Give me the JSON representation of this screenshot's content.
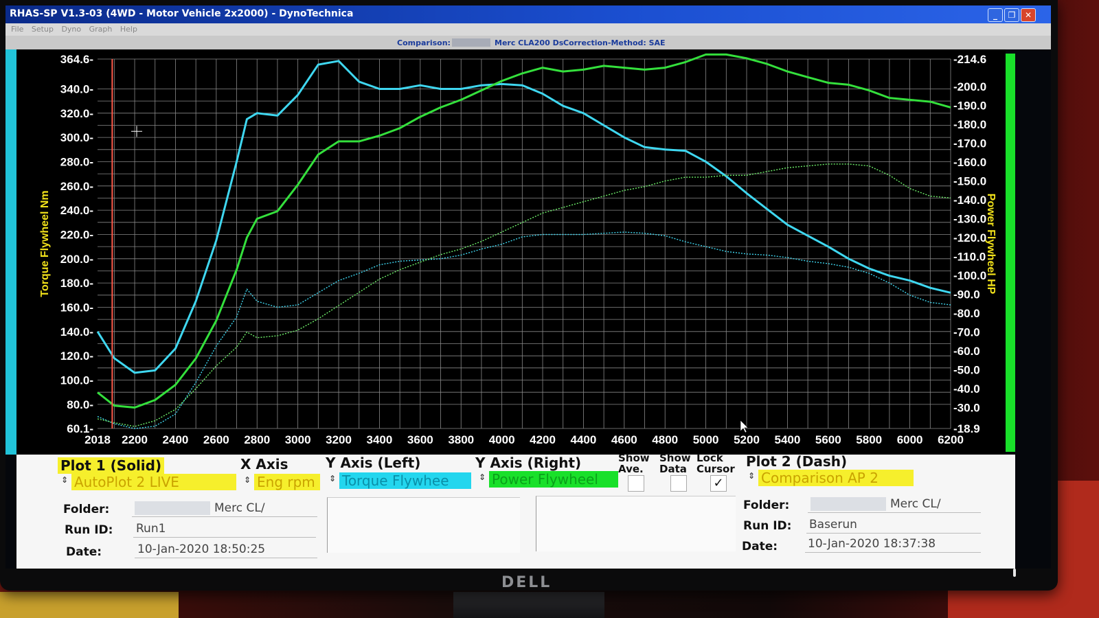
{
  "window": {
    "title": "RHAS-SP V1.3-03  (4WD - Motor Vehicle 2x2000) - DynoTechnica",
    "controls": [
      "_",
      "❐",
      "✕"
    ]
  },
  "menu": {
    "items": [
      "File",
      "Setup",
      "Dyno",
      "Graph",
      "Help"
    ]
  },
  "infobar": {
    "comparison_label": "Comparison:",
    "vehicle": "Merc CLA200 Ds",
    "correction_label": "Correction-Method: SAE"
  },
  "chart_data": {
    "type": "line",
    "x": [
      2018,
      2100,
      2200,
      2300,
      2400,
      2500,
      2600,
      2700,
      2750,
      2800,
      2900,
      3000,
      3100,
      3200,
      3300,
      3400,
      3500,
      3600,
      3700,
      3800,
      3900,
      4000,
      4100,
      4200,
      4300,
      4400,
      4500,
      4600,
      4700,
      4800,
      4900,
      5000,
      5100,
      5200,
      5300,
      5400,
      5500,
      5600,
      5700,
      5800,
      5900,
      6000,
      6100,
      6200
    ],
    "xlim": [
      2018,
      6200
    ],
    "x_ticks": [
      "2018",
      "2200",
      "2400",
      "2600",
      "2800",
      "3000",
      "3200",
      "3400",
      "3600",
      "3800",
      "4000",
      "4200",
      "4400",
      "4600",
      "4800",
      "5000",
      "5200",
      "5400",
      "5600",
      "5800",
      "6000",
      "6200"
    ],
    "ylabel": "Torque Flywheel Nm",
    "ylim": [
      60.1,
      364.6
    ],
    "y_ticks": [
      "364.6-",
      "340.0-",
      "320.0-",
      "300.0-",
      "280.0-",
      "260.0-",
      "240.0-",
      "220.0-",
      "200.0-",
      "180.0-",
      "160.0-",
      "140.0-",
      "120.0-",
      "100.0-",
      "80.0-",
      "60.1-"
    ],
    "y_tick_values": [
      364.6,
      340,
      320,
      300,
      280,
      260,
      240,
      220,
      200,
      180,
      160,
      140,
      120,
      100,
      80,
      60.1
    ],
    "y2label": "Power Flywheel HP",
    "y2lim": [
      18.9,
      214.6
    ],
    "y2_ticks": [
      "214.6",
      "200.0",
      "190.0",
      "180.0",
      "170.0",
      "160.0",
      "150.0",
      "140.0",
      "130.0",
      "120.0",
      "110.0",
      "100.0",
      "90.0",
      "80.0",
      "70.0",
      "60.0",
      "50.0",
      "40.0",
      "30.0",
      "18.9"
    ],
    "y2_tick_values": [
      214.6,
      200,
      190,
      180,
      170,
      160,
      150,
      140,
      130,
      120,
      110,
      100,
      90,
      80,
      70,
      60,
      50,
      40,
      30,
      18.9
    ],
    "grid": true,
    "cursor_rpm": 2090,
    "series": [
      {
        "axis": "left",
        "color": "#3fd7f0",
        "dash": false,
        "values": [
          140,
          118,
          106,
          108,
          126,
          165,
          215,
          280,
          315,
          320,
          318,
          335,
          360,
          363,
          346,
          340,
          340,
          343,
          340,
          340,
          343,
          344,
          343,
          336,
          326,
          320,
          310,
          300,
          292,
          290,
          289,
          280,
          268,
          254,
          241,
          228,
          219,
          210,
          200,
          192,
          186,
          182,
          176,
          172
        ]
      },
      {
        "axis": "right",
        "color": "#34e03c",
        "dash": false,
        "values": [
          38,
          31,
          30,
          34,
          42,
          56,
          76,
          103,
          120,
          130,
          134,
          148,
          164,
          171,
          171,
          174,
          178,
          184,
          189,
          193,
          198,
          203,
          207,
          210,
          208,
          209,
          211,
          210,
          209,
          210,
          213,
          217,
          217,
          215,
          212,
          208,
          205,
          202,
          201,
          198,
          194,
          193,
          192,
          189
        ]
      },
      {
        "axis": "left",
        "color": "#3fd7f0",
        "dash": true,
        "values": [
          70,
          64,
          60,
          62,
          72,
          98,
          128,
          152,
          175,
          165,
          160,
          162,
          172,
          182,
          188,
          195,
          198,
          199,
          200,
          203,
          208,
          212,
          218,
          220,
          220,
          220,
          221,
          222,
          221,
          219,
          214,
          210,
          206,
          204,
          203,
          201,
          198,
          196,
          193,
          188,
          180,
          170,
          164,
          162
        ]
      },
      {
        "axis": "right",
        "color": "#6ef06a",
        "dash": true,
        "values": [
          24,
          22,
          20,
          23,
          29,
          40,
          52,
          62,
          70,
          67,
          68,
          71,
          77,
          84,
          91,
          98,
          103,
          107,
          111,
          114,
          118,
          123,
          128,
          133,
          136,
          139,
          142,
          145,
          147,
          150,
          152,
          152,
          153,
          153,
          155,
          157,
          158,
          159,
          159,
          158,
          153,
          146,
          142,
          141
        ]
      }
    ]
  },
  "controls": {
    "plot1_label": "Plot 1 (Solid)",
    "xaxis_label": "X Axis",
    "yleft_label": "Y Axis (Left)",
    "yright_label": "Y Axis (Right)",
    "show_ave_label_1": "Show",
    "show_ave_label_2": "Ave.",
    "show_data_label_1": "Show",
    "show_data_label_2": "Data",
    "lock_cursor_label_1": "Lock",
    "lock_cursor_label_2": "Cursor",
    "plot2_label": "Plot 2 (Dash)",
    "plot1_select": "AutoPlot 2 LIVE",
    "xaxis_select": "Eng rpm",
    "yleft_select": "Torque Flywhee",
    "yright_select": "Power Flywheel",
    "plot2_select": "Comparison AP 2",
    "lock_cursor_check": "✓",
    "spinner": "⇕",
    "colors": {
      "yellow": "#f6ef2c",
      "cyan": "#23d6ee",
      "green": "#19e02a"
    }
  },
  "plot1": {
    "folder_label": "Folder:",
    "folder_value": "Merc CL/",
    "runid_label": "Run ID:",
    "runid_value": "Run1",
    "date_label": "Date:",
    "date_value": "10-Jan-2020  18:50:25"
  },
  "plot2": {
    "folder_label": "Folder:",
    "folder_value": "Merc CL/",
    "runid_label": "Run ID:",
    "runid_value": "Baserun",
    "date_label": "Date:",
    "date_value": "10-Jan-2020  18:37:38"
  },
  "monitor": {
    "brand": "DELL"
  }
}
